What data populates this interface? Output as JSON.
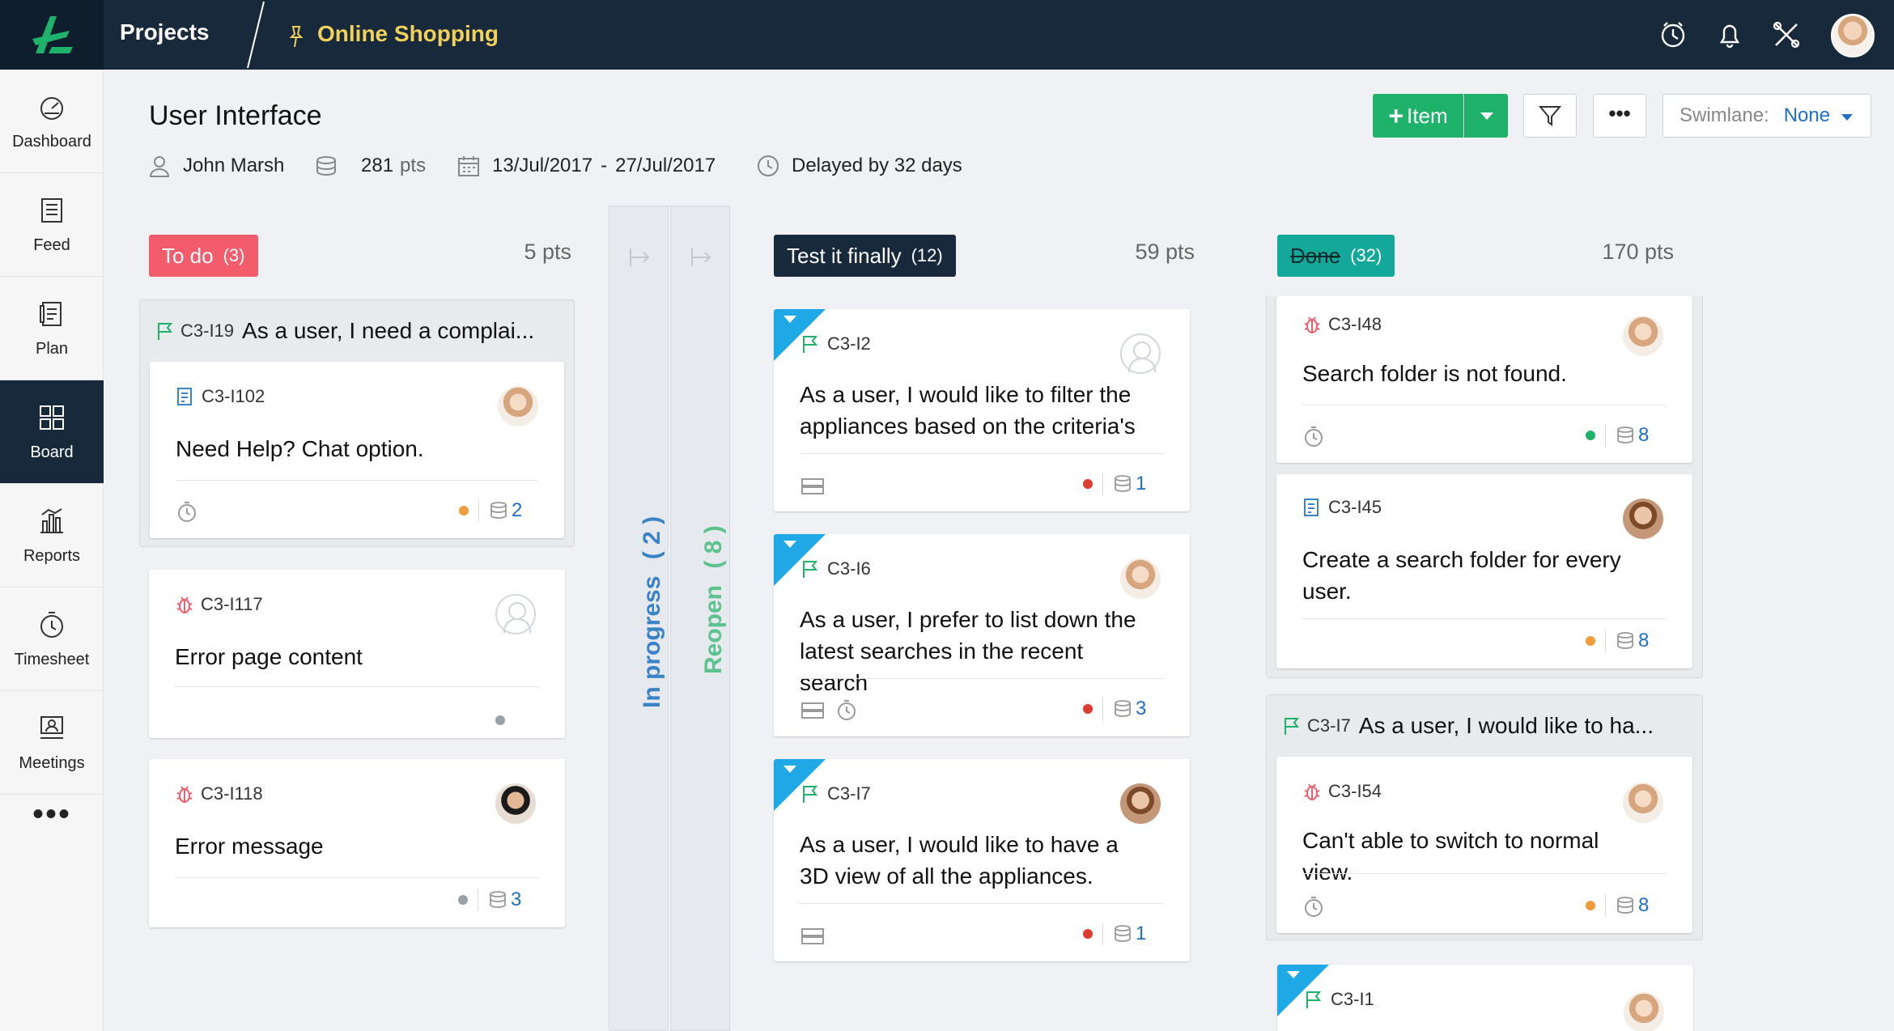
{
  "topbar": {
    "projects_label": "Projects",
    "project_name": "Online Shopping"
  },
  "sidebar": {
    "items": [
      {
        "label": "Dashboard",
        "icon": "dashboard-icon"
      },
      {
        "label": "Feed",
        "icon": "feed-icon"
      },
      {
        "label": "Plan",
        "icon": "plan-icon"
      },
      {
        "label": "Board",
        "icon": "board-icon",
        "active": true
      },
      {
        "label": "Reports",
        "icon": "reports-icon"
      },
      {
        "label": "Timesheet",
        "icon": "timesheet-icon"
      },
      {
        "label": "Meetings",
        "icon": "meetings-icon"
      }
    ],
    "more": "•••"
  },
  "header": {
    "title": "User Interface",
    "owner": "John Marsh",
    "points": "281",
    "points_unit": "pts",
    "date_start": "13/Jul/2017",
    "date_sep": "-",
    "date_end": "27/Jul/2017",
    "delay": "Delayed by 32 days"
  },
  "toolbar": {
    "add_label": "Item",
    "swimlane_label": "Swimlane:",
    "swimlane_value": "None",
    "more": "•••"
  },
  "colors": {
    "todo": "#f25c6b",
    "test": "#17293b",
    "done": "#14a89b",
    "accent_blue": "#1ea8e6",
    "in_progress": "#3b83c7",
    "reopen": "#5cc28e"
  },
  "columns": {
    "todo": {
      "name": "To do",
      "count": "(3)",
      "points": "5 pts",
      "group": {
        "id": "C3-I19",
        "title": "As a user, I need a complai..."
      },
      "cards": [
        {
          "id": "C3-I102",
          "title": "Need Help? Chat option.",
          "points": "2"
        },
        {
          "id": "C3-I117",
          "title": "Error page content"
        },
        {
          "id": "C3-I118",
          "title": "Error message",
          "points": "3"
        }
      ]
    },
    "in_progress": {
      "name": "In progress",
      "count": "( 2 )"
    },
    "reopen": {
      "name": "Reopen",
      "count": "( 8 )"
    },
    "test": {
      "name": "Test it finally",
      "count": "(12)",
      "points": "59 pts",
      "cards": [
        {
          "id": "C3-I2",
          "title": "As a user, I would like to filter the appliances based on the criteria's",
          "points": "1"
        },
        {
          "id": "C3-I6",
          "title": "As a user, I prefer to list down the latest searches in the recent search",
          "points": "3"
        },
        {
          "id": "C3-I7",
          "title": "As a user, I would like to have a 3D view of all the appliances.",
          "points": "1"
        }
      ]
    },
    "done": {
      "name": "Done",
      "count": "(32)",
      "points": "170 pts",
      "cards": [
        {
          "id": "C3-I48",
          "title": "Search folder is not found.",
          "points": "8"
        },
        {
          "id": "C3-I45",
          "title": "Create a search folder for every user.",
          "points": "8"
        }
      ],
      "group": {
        "id": "C3-I7",
        "title": "As a user, I would like to ha...",
        "cards": [
          {
            "id": "C3-I54",
            "title": "Can't able to switch to normal view.",
            "points": "8"
          }
        ]
      },
      "last_card": {
        "id": "C3-I1"
      }
    }
  }
}
